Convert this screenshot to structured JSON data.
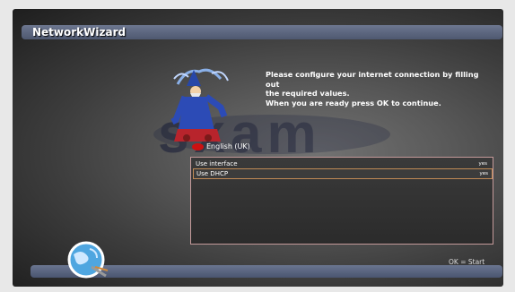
{
  "window": {
    "title": "NetworkWizard"
  },
  "logo": {
    "text": "sxam"
  },
  "info_text": {
    "line1": "Please configure your internet connection by filling out",
    "line2": "the required values.",
    "line3": "When you are ready press OK to continue."
  },
  "language": {
    "label": "English (UK)"
  },
  "list": {
    "items": [
      {
        "label": "Use interface",
        "value": "yes",
        "selected": false
      },
      {
        "label": "Use DHCP",
        "value": "yes",
        "selected": true
      }
    ]
  },
  "footer": {
    "hint": "OK  =  Start"
  },
  "colors": {
    "accent_bar": "#5b6680",
    "selection_border": "#c08a55",
    "list_border": "#c49a9a"
  }
}
